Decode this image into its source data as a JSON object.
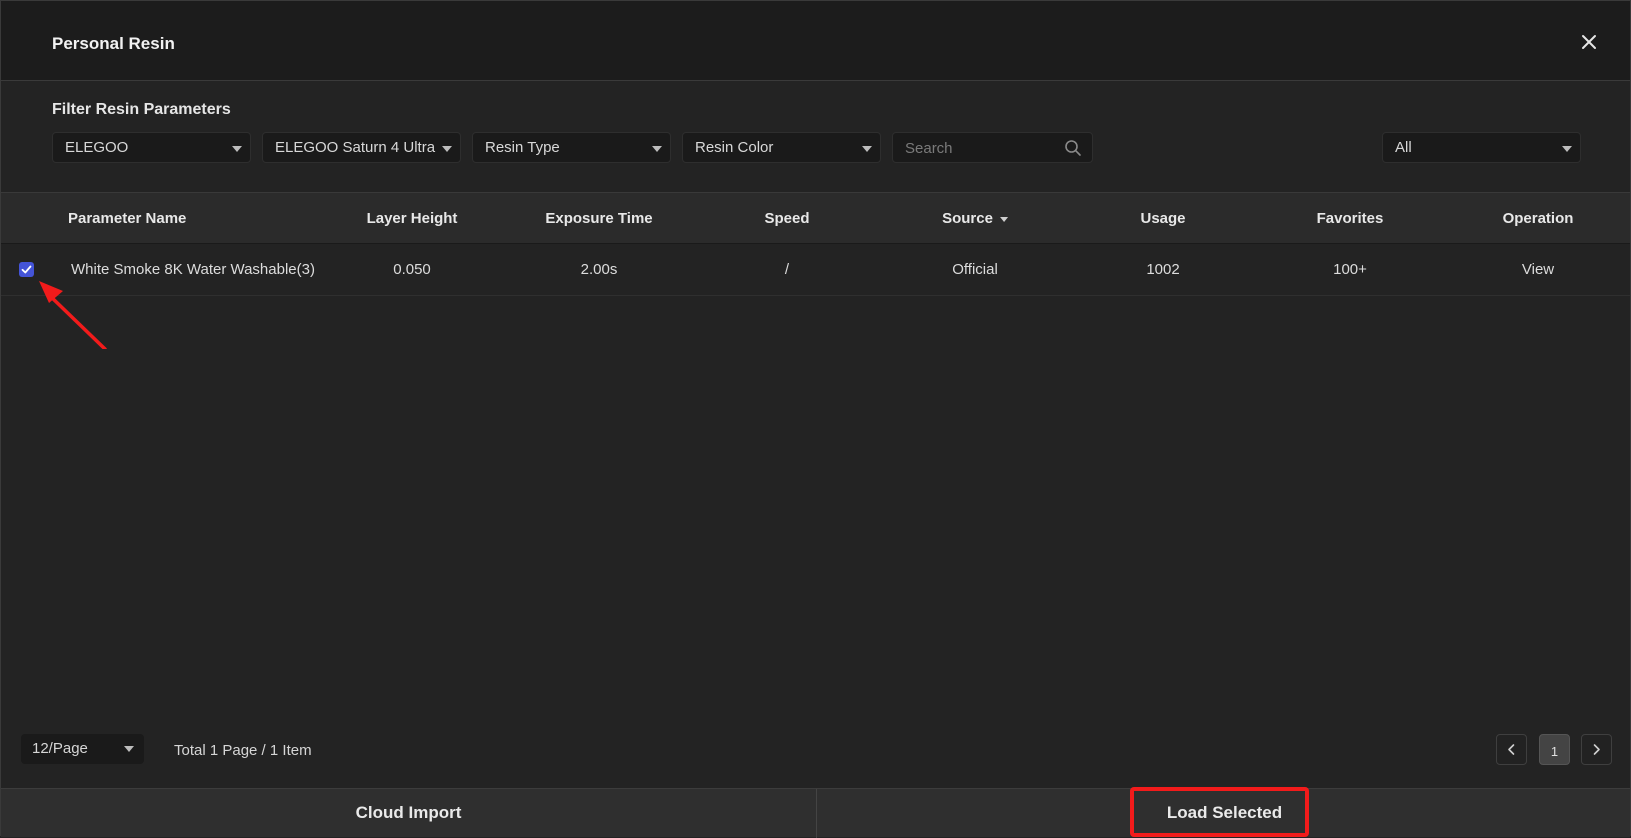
{
  "dialog": {
    "title": "Personal Resin"
  },
  "filters": {
    "heading": "Filter Resin Parameters",
    "brand": "ELEGOO",
    "printer": "ELEGOO Saturn 4 Ultra",
    "resin_type": "Resin Type",
    "resin_color": "Resin Color",
    "search_placeholder": "Search",
    "scope": "All"
  },
  "table": {
    "columns": [
      "Parameter Name",
      "Layer Height",
      "Exposure Time",
      "Speed",
      "Source",
      "Usage",
      "Favorites",
      "Operation"
    ],
    "rows": [
      {
        "checked": true,
        "name": "White Smoke 8K Water Washable(3)",
        "layer_height": "0.050",
        "exposure_time": "2.00s",
        "speed": "/",
        "source": "Official",
        "usage": "1002",
        "favorites": "100+",
        "operation": "View"
      }
    ]
  },
  "pagination": {
    "page_size": "12/Page",
    "summary": "Total 1 Page / 1 Item",
    "current_page": "1"
  },
  "footer": {
    "cloud_import": "Cloud Import",
    "load_selected": "Load Selected"
  },
  "colors": {
    "accent": "#4454d8",
    "annotation": "#f21b1b",
    "background": "#232323"
  },
  "icons": [
    "close-icon",
    "chevron-down-icon",
    "search-icon",
    "check-icon",
    "sort-caret-icon",
    "chevron-left-icon",
    "chevron-right-icon",
    "arrow-annotation"
  ]
}
